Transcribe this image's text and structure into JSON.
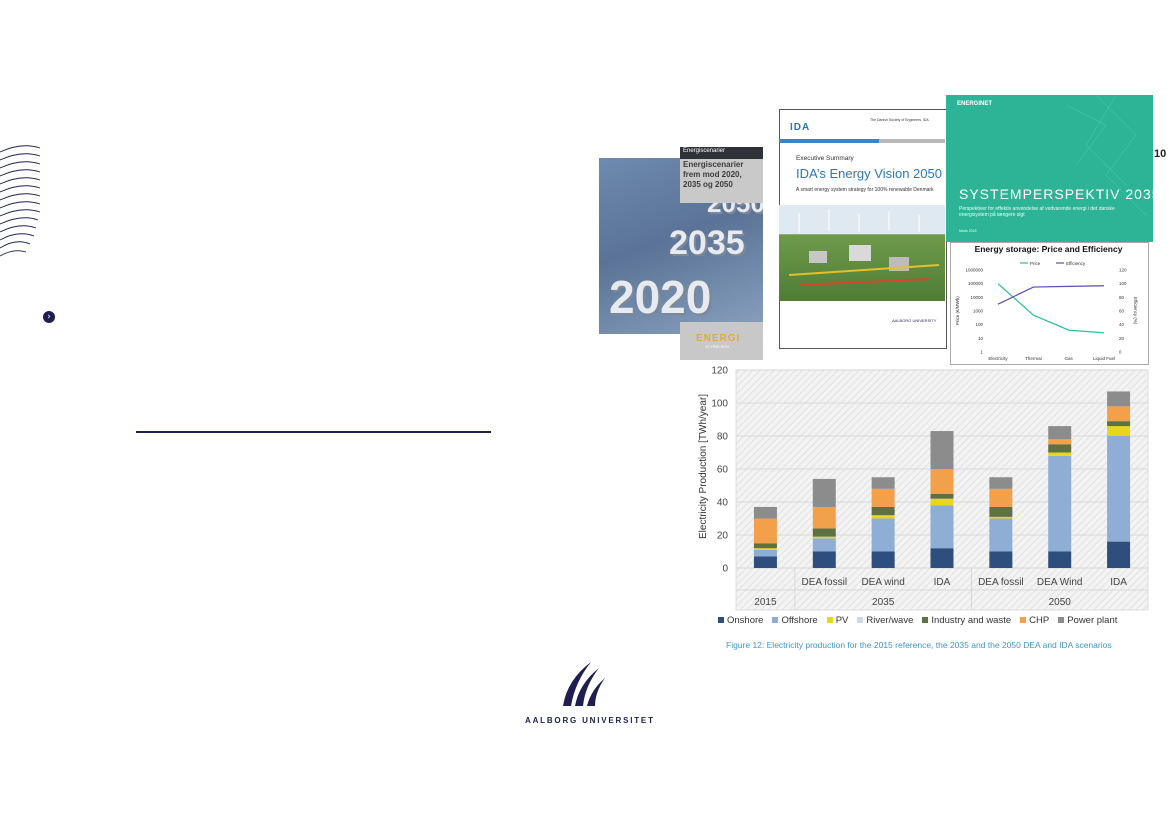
{
  "slide": {
    "number": "10"
  },
  "covers": {
    "energiscenarier": {
      "band_label": "Energiscenarier",
      "title": "Energiscenarier frem mod 2020, 2035 og 2050",
      "years": [
        "2050",
        "2035",
        "2020"
      ],
      "logo": "ENERGI",
      "logo_sub": "STYRELSEN"
    },
    "ida": {
      "logo": "IDA",
      "publisher_lines": "The Danish Society of Engineers, IDA",
      "label": "Executive Summary",
      "title": "IDA’s Energy Vision 2050",
      "subtitle": "A smart energy system strategy for 100% renewable Denmark",
      "university": "AALBORG UNIVERSITY"
    },
    "systemperspektiv": {
      "brand": "ENERGINET",
      "title": "SYSTEMPERSPEKTIV 2035",
      "subtitle": "Perspektiver for effektiv anvendelse af vedvarende energi i det danske energisystem på længere sigt",
      "date": "Marts 2018"
    }
  },
  "storage_chart": {
    "type": "line",
    "title": "Energy storage: Price and Efficiency",
    "legend": [
      "Price",
      "Efficiency"
    ],
    "categories": [
      "Electricity",
      "Thermal",
      "Gas",
      "Liquid Fuel"
    ],
    "y_left_label": "Price (€/MWh)",
    "y_left_ticks": [
      "1000000",
      "100000",
      "10000",
      "1000",
      "100",
      "10",
      "1"
    ],
    "y_right_label": "Efficiency (%)",
    "y_right_ticks": [
      "120",
      "100",
      "80",
      "60",
      "40",
      "20",
      "0"
    ],
    "series": [
      {
        "name": "Price",
        "color": "#2bbf9c",
        "values": [
          100000,
          500,
          40,
          25
        ]
      },
      {
        "name": "Efficiency",
        "color": "#5b4bb5",
        "values": [
          70,
          95,
          96,
          97
        ]
      }
    ]
  },
  "chart_data": {
    "type": "bar",
    "stacked": true,
    "ylabel": "Electricity Production [TWh/year]",
    "ylim": [
      0,
      120
    ],
    "yticks": [
      "0",
      "20",
      "40",
      "60",
      "80",
      "100",
      "120"
    ],
    "categories": [
      "",
      "DEA fossil",
      "DEA wind",
      "IDA",
      "DEA fossil",
      "DEA Wind",
      "IDA"
    ],
    "groups": [
      {
        "label": "2015",
        "span": 1
      },
      {
        "label": "2035",
        "span": 3
      },
      {
        "label": "2050",
        "span": 3
      }
    ],
    "series": [
      {
        "name": "Onshore",
        "color": "#2e4e7e",
        "values": [
          7,
          10,
          10,
          12,
          10,
          10,
          16
        ]
      },
      {
        "name": "Offshore",
        "color": "#8eaed6",
        "values": [
          4,
          8,
          20,
          26,
          20,
          58,
          64
        ]
      },
      {
        "name": "PV",
        "color": "#e8d618",
        "values": [
          1,
          1,
          2,
          4,
          1,
          2,
          6
        ]
      },
      {
        "name": "River/wave",
        "color": "#cfd8e8",
        "values": [
          0,
          0,
          0,
          0,
          0,
          0,
          0
        ]
      },
      {
        "name": "Industry and waste",
        "color": "#5f7043",
        "values": [
          3,
          5,
          5,
          3,
          6,
          5,
          3
        ]
      },
      {
        "name": "CHP",
        "color": "#f2a04a",
        "values": [
          15,
          13,
          11,
          15,
          11,
          3,
          9
        ]
      },
      {
        "name": "Power plant",
        "color": "#8c8c8c",
        "values": [
          7,
          17,
          7,
          23,
          7,
          8,
          9
        ]
      }
    ],
    "caption": "Figure 12: Electricity production for the 2015 reference, the 2035 and the 2050 DEA and IDA scenarios"
  },
  "university": {
    "name": "AALBORG UNIVERSITET"
  }
}
